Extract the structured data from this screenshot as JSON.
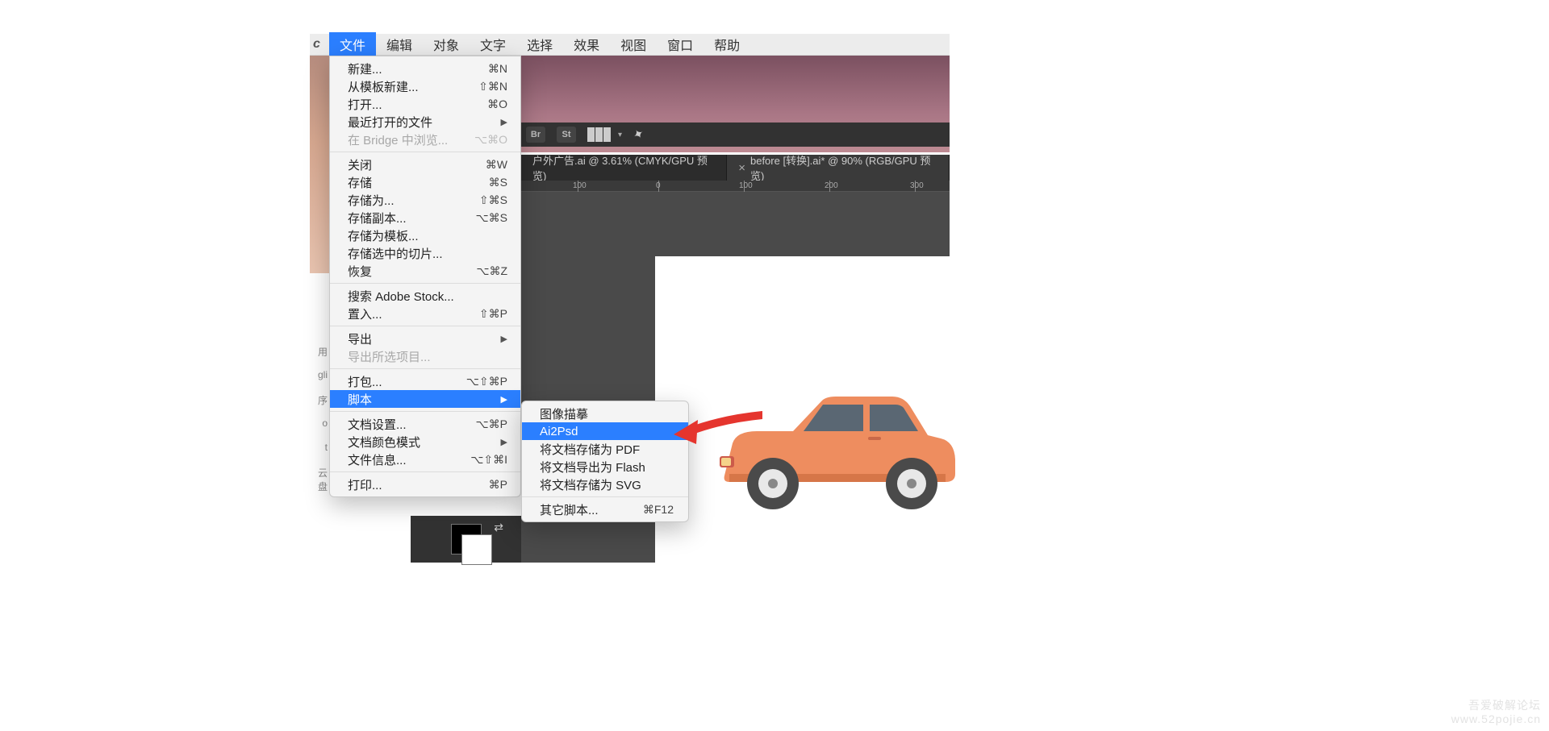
{
  "menubar": {
    "items": [
      "文件",
      "编辑",
      "对象",
      "文字",
      "选择",
      "效果",
      "视图",
      "窗口",
      "帮助"
    ],
    "active_index": 0
  },
  "dropdown": [
    {
      "label": "新建...",
      "sc": "⌘N"
    },
    {
      "label": "从模板新建...",
      "sc": "⇧⌘N"
    },
    {
      "label": "打开...",
      "sc": "⌘O"
    },
    {
      "label": "最近打开的文件",
      "arrow": true
    },
    {
      "label": "在 Bridge 中浏览...",
      "sc": "⌥⌘O",
      "disabled": true
    },
    {
      "sep": true
    },
    {
      "label": "关闭",
      "sc": "⌘W"
    },
    {
      "label": "存储",
      "sc": "⌘S"
    },
    {
      "label": "存储为...",
      "sc": "⇧⌘S"
    },
    {
      "label": "存储副本...",
      "sc": "⌥⌘S"
    },
    {
      "label": "存储为模板..."
    },
    {
      "label": "存储选中的切片..."
    },
    {
      "label": "恢复",
      "sc": "⌥⌘Z"
    },
    {
      "sep": true
    },
    {
      "label": "搜索 Adobe Stock..."
    },
    {
      "label": "置入...",
      "sc": "⇧⌘P"
    },
    {
      "sep": true
    },
    {
      "label": "导出",
      "arrow": true
    },
    {
      "label": "导出所选项目...",
      "disabled": true
    },
    {
      "sep": true
    },
    {
      "label": "打包...",
      "sc": "⌥⇧⌘P"
    },
    {
      "label": "脚本",
      "arrow": true,
      "highlight": true
    },
    {
      "sep": true
    },
    {
      "label": "文档设置...",
      "sc": "⌥⌘P"
    },
    {
      "label": "文档颜色模式",
      "arrow": true
    },
    {
      "label": "文件信息...",
      "sc": "⌥⇧⌘I"
    },
    {
      "sep": true
    },
    {
      "label": "打印...",
      "sc": "⌘P"
    }
  ],
  "submenu": [
    {
      "label": "图像描摹"
    },
    {
      "label": "Ai2Psd",
      "highlight": true
    },
    {
      "label": "将文档存储为 PDF"
    },
    {
      "label": "将文档导出为 Flash"
    },
    {
      "label": "将文档存储为 SVG"
    },
    {
      "sep": true
    },
    {
      "label": "其它脚本...",
      "sc": "⌘F12"
    }
  ],
  "topbar_icons": {
    "br": "Br",
    "st": "St"
  },
  "tabs": [
    {
      "label": "户外广告.ai @ 3.61% (CMYK/GPU 预览)",
      "active": false
    },
    {
      "label": "before [转换].ai* @ 90% (RGB/GPU 预览)",
      "active": true,
      "close": "×"
    }
  ],
  "ruler": [
    {
      "pos": 70,
      "label": "100"
    },
    {
      "pos": 170,
      "label": "0"
    },
    {
      "pos": 276,
      "label": "100"
    },
    {
      "pos": 382,
      "label": "200"
    },
    {
      "pos": 488,
      "label": "300"
    }
  ],
  "leftfrag": [
    "用",
    "gli",
    "序",
    "o",
    "t",
    "云盘"
  ],
  "watermark": {
    "l1": "吾爱破解论坛",
    "l2": "www.52pojie.cn"
  }
}
